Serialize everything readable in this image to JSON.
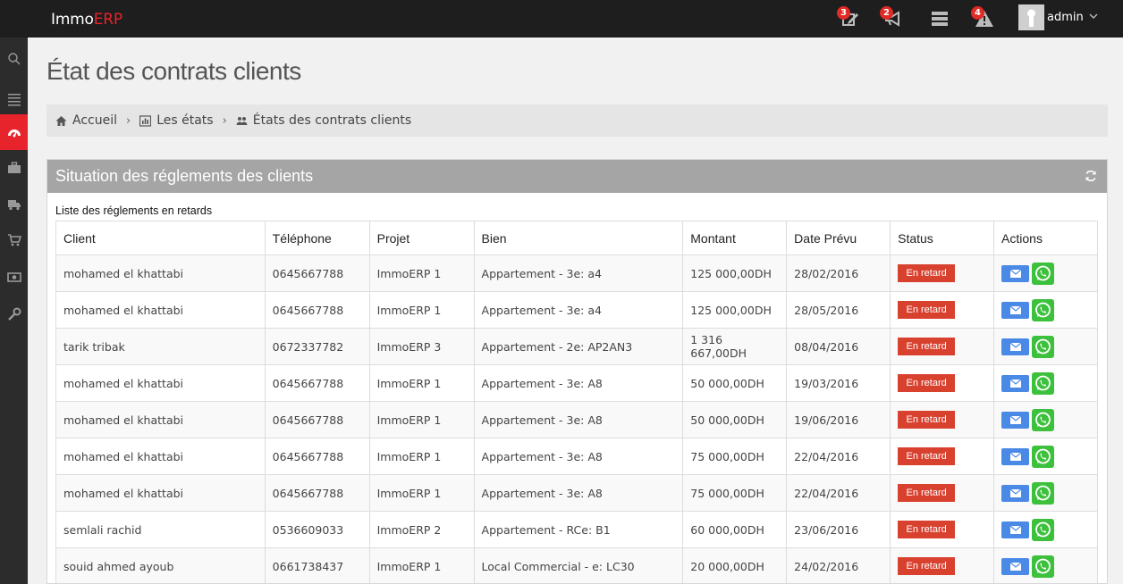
{
  "app": {
    "brand_prefix": "Immo",
    "brand_accent": "ERP"
  },
  "topbar": {
    "notifications": [
      {
        "icon": "edit-icon",
        "count": "3"
      },
      {
        "icon": "megaphone-icon",
        "count": "2"
      },
      {
        "icon": "server-icon",
        "count": ""
      },
      {
        "icon": "warning-icon",
        "count": "4"
      }
    ],
    "user_label": "admin"
  },
  "sidebar": {
    "items": [
      {
        "icon": "search-icon",
        "active": false
      },
      {
        "icon": "menu-icon",
        "active": false
      },
      {
        "icon": "dashboard-icon",
        "active": true
      },
      {
        "icon": "briefcase-icon",
        "active": false
      },
      {
        "icon": "truck-icon",
        "active": false
      },
      {
        "icon": "cart-icon",
        "active": false
      },
      {
        "icon": "money-icon",
        "active": false
      },
      {
        "icon": "wrench-icon",
        "active": false
      }
    ]
  },
  "page": {
    "title": "État des contrats clients"
  },
  "breadcrumb": {
    "items": [
      {
        "label": "Accueil",
        "icon": "home-icon"
      },
      {
        "label": "Les états",
        "icon": "bar-chart-icon"
      },
      {
        "label": "États des contrats clients",
        "icon": "users-icon"
      }
    ]
  },
  "panel": {
    "title": "Situation des réglements des clients",
    "caption": "Liste des réglements en retards",
    "columns": [
      "Client",
      "Téléphone",
      "Projet",
      "Bien",
      "Montant",
      "Date Prévu",
      "Status",
      "Actions"
    ],
    "rows": [
      [
        "mohamed el khattabi",
        "0645667788",
        "ImmoERP 1",
        "Appartement - 3e: a4",
        "125 000,00DH",
        "28/02/2016",
        "En retard"
      ],
      [
        "mohamed el khattabi",
        "0645667788",
        "ImmoERP 1",
        "Appartement - 3e: a4",
        "125 000,00DH",
        "28/05/2016",
        "En retard"
      ],
      [
        "tarik tribak",
        "0672337782",
        "ImmoERP 3",
        "Appartement - 2e: AP2AN3",
        "1 316 667,00DH",
        "08/04/2016",
        "En retard"
      ],
      [
        "mohamed el khattabi",
        "0645667788",
        "ImmoERP 1",
        "Appartement - 3e: A8",
        "50 000,00DH",
        "19/03/2016",
        "En retard"
      ],
      [
        "mohamed el khattabi",
        "0645667788",
        "ImmoERP 1",
        "Appartement - 3e: A8",
        "50 000,00DH",
        "19/06/2016",
        "En retard"
      ],
      [
        "mohamed el khattabi",
        "0645667788",
        "ImmoERP 1",
        "Appartement - 3e: A8",
        "75 000,00DH",
        "22/04/2016",
        "En retard"
      ],
      [
        "mohamed el khattabi",
        "0645667788",
        "ImmoERP 1",
        "Appartement - 3e: A8",
        "75 000,00DH",
        "22/04/2016",
        "En retard"
      ],
      [
        "semlali rachid",
        "0536609033",
        "ImmoERP 2",
        "Appartement - RCe: B1",
        "60 000,00DH",
        "23/06/2016",
        "En retard"
      ],
      [
        "souid ahmed ayoub",
        "0661738437",
        "ImmoERP 1",
        "Local Commercial - e: LC30",
        "20 000,00DH",
        "24/02/2016",
        "En retard"
      ]
    ]
  },
  "colors": {
    "accent": "#e7232b",
    "status_late": "#d9412f",
    "mail_button": "#4a8ae6",
    "whatsapp_button": "#3dc13d"
  }
}
